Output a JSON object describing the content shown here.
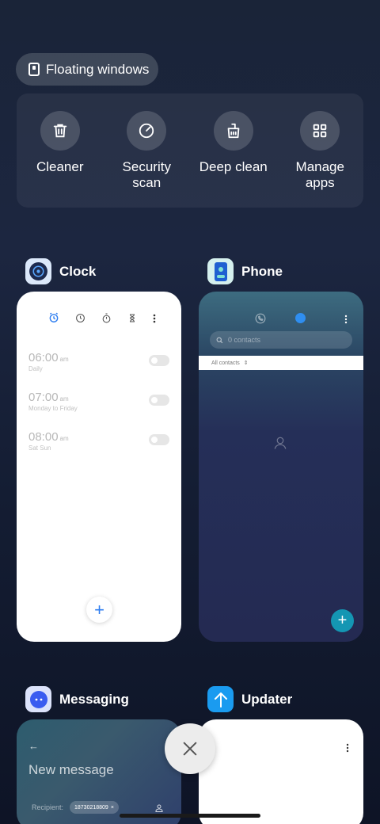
{
  "floating_windows": {
    "label": "Floating windows"
  },
  "tools": [
    {
      "label": "Cleaner",
      "icon": "trash-icon"
    },
    {
      "label": "Security scan",
      "icon": "security-scan-icon"
    },
    {
      "label": "Deep clean",
      "icon": "deep-clean-icon"
    },
    {
      "label": "Manage apps",
      "icon": "grid-icon"
    }
  ],
  "apps": {
    "clock": {
      "name": "Clock",
      "alarms": [
        {
          "time": "06:00",
          "period": "am",
          "repeat": "Daily"
        },
        {
          "time": "07:00",
          "period": "am",
          "repeat": "Monday to Friday"
        },
        {
          "time": "08:00",
          "period": "am",
          "repeat": "Sat Sun"
        }
      ]
    },
    "phone": {
      "name": "Phone",
      "search_placeholder": "0 contacts",
      "filter_label": "All contacts"
    },
    "messaging": {
      "name": "Messaging",
      "title": "New message",
      "recipient_label": "Recipient:",
      "recipient_value": "18730218809"
    },
    "updater": {
      "name": "Updater"
    }
  },
  "colors": {
    "accent_blue": "#2f7ef0",
    "teal": "#1496b3",
    "updater_blue": "#1a9bf0"
  }
}
